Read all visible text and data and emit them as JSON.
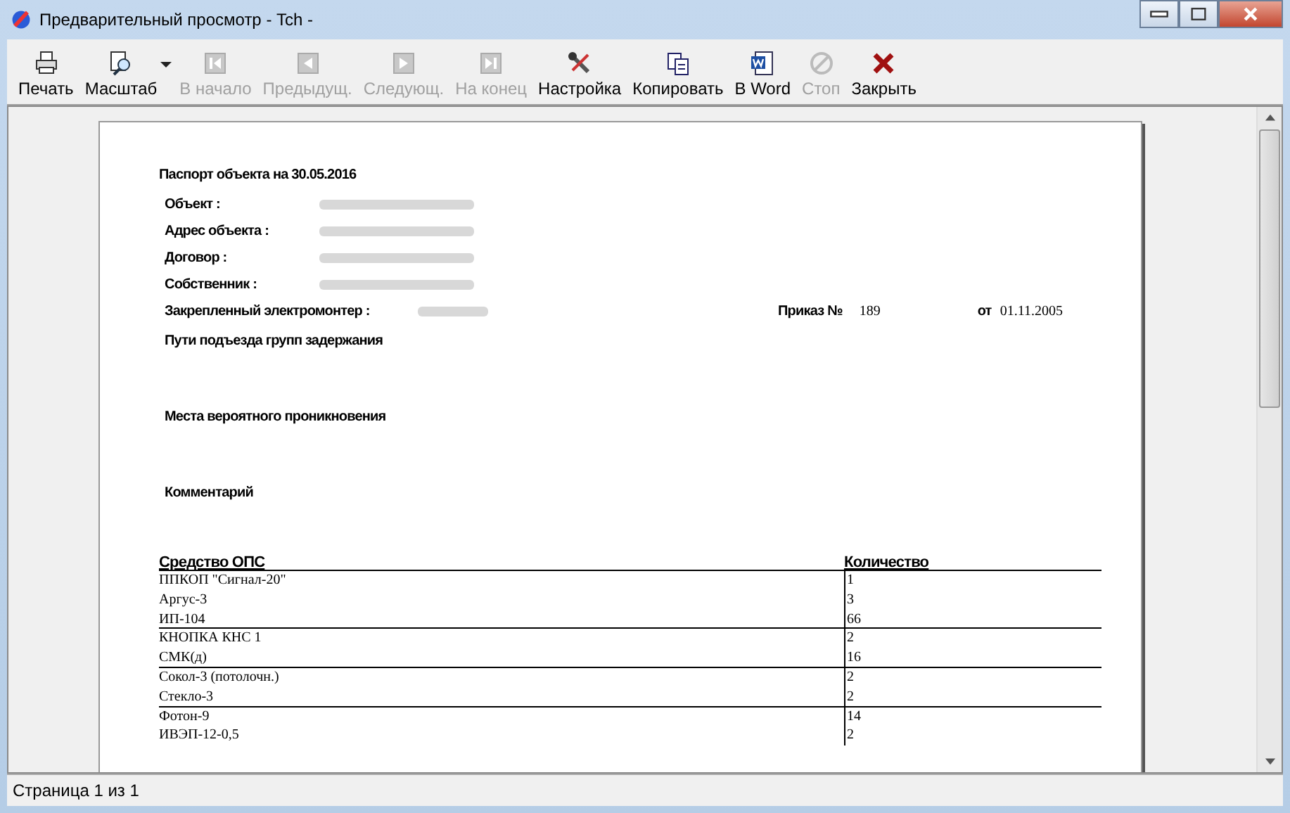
{
  "window": {
    "title": "Предварительный просмотр - Tch -"
  },
  "toolbar": [
    {
      "label": "Печать",
      "disabled": false,
      "dropdown": false
    },
    {
      "label": "Масштаб",
      "disabled": false,
      "dropdown": true
    },
    {
      "label": "В начало",
      "disabled": true,
      "dropdown": false
    },
    {
      "label": "Предыдущ.",
      "disabled": true,
      "dropdown": false
    },
    {
      "label": "Следующ.",
      "disabled": true,
      "dropdown": false
    },
    {
      "label": "На конец",
      "disabled": true,
      "dropdown": false
    },
    {
      "label": "Настройка",
      "disabled": false,
      "dropdown": false
    },
    {
      "label": "Копировать",
      "disabled": false,
      "dropdown": false
    },
    {
      "label": "В Word",
      "disabled": false,
      "dropdown": false
    },
    {
      "label": "Стоп",
      "disabled": true,
      "dropdown": false
    },
    {
      "label": "Закрыть",
      "disabled": false,
      "dropdown": false
    }
  ],
  "document": {
    "title": "Паспорт объекта на 30.05.2016",
    "fields": [
      {
        "label": "Объект :"
      },
      {
        "label": "Адрес объекта :"
      },
      {
        "label": "Договор :"
      },
      {
        "label": "Собственник :"
      }
    ],
    "assignee": {
      "label": "Закрепленный электромонтер :",
      "order_label": "Приказ №",
      "order_number": "189",
      "date_label": "от",
      "date": "01.11.2005"
    },
    "sections": [
      "Пути подъезда групп задержания",
      "Места вероятного проникновения",
      "Комментарий"
    ],
    "table": {
      "columns": [
        "Средство ОПС",
        "Количество"
      ],
      "rows": [
        {
          "name": "ППКОП \"Сигнал-20\"",
          "count": "1",
          "divider_after": false
        },
        {
          "name": "Аргус-3",
          "count": "3",
          "divider_after": false
        },
        {
          "name": "ИП-104",
          "count": "66",
          "divider_after": true
        },
        {
          "name": "КНОПКА  КНС 1",
          "count": "2",
          "divider_after": false
        },
        {
          "name": "СМК(д)",
          "count": "16",
          "divider_after": true
        },
        {
          "name": "Сокол-3 (потолочн.)",
          "count": "2",
          "divider_after": false
        },
        {
          "name": "Стекло-3",
          "count": "2",
          "divider_after": true
        },
        {
          "name": "Фотон-9",
          "count": "14",
          "divider_after": false
        },
        {
          "name": "ИВЭП-12-0,5",
          "count": "2",
          "divider_after": false
        }
      ]
    }
  },
  "status_bar": {
    "text": "Страница 1 из 1"
  }
}
